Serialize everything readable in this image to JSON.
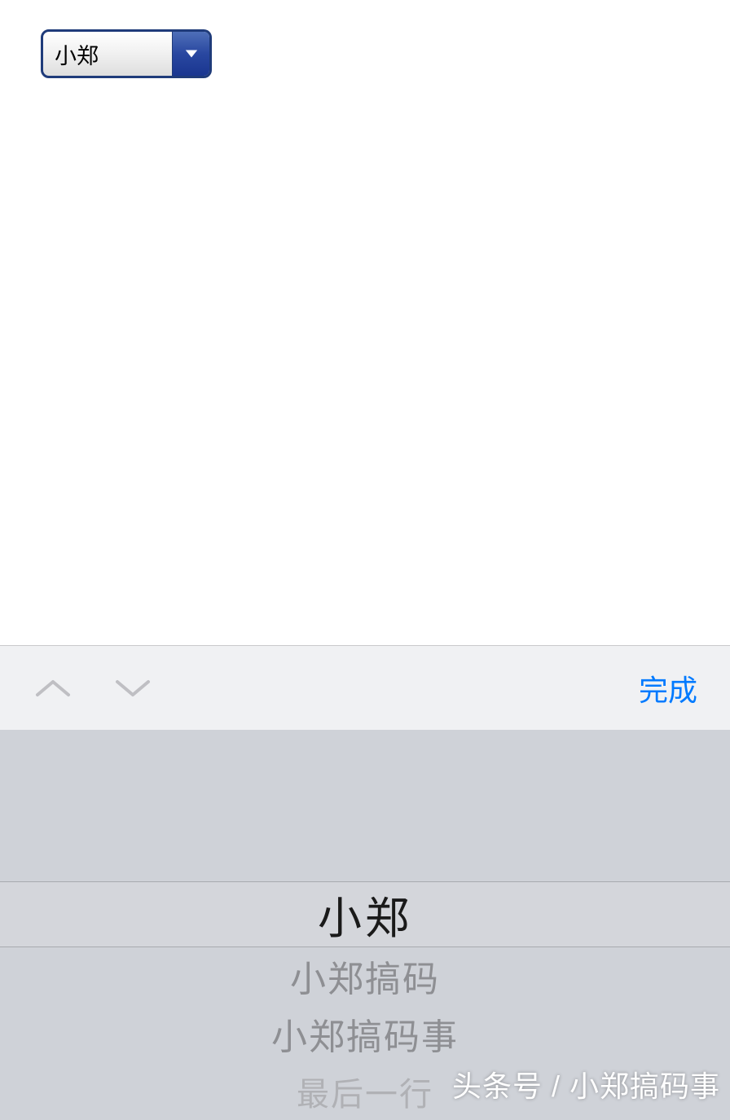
{
  "select": {
    "value": "小郑"
  },
  "toolbar": {
    "done_label": "完成"
  },
  "picker": {
    "options": [
      "小郑",
      "小郑搞码",
      "小郑搞码事",
      "最后一行"
    ],
    "selected_index": 0
  },
  "watermark": "头条号 / 小郑搞码事"
}
